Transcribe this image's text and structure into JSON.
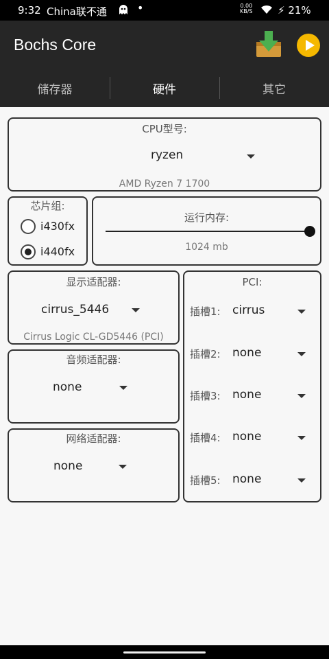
{
  "status": {
    "time": "9:32",
    "carrier": "China联不通",
    "ghost_icon": "ghost-icon",
    "dot": "•",
    "net_value": "0.00",
    "net_unit": "KB/S",
    "battery": "21%"
  },
  "appbar": {
    "title": "Bochs Core",
    "download_icon": "download-box-icon",
    "play_icon": "play-icon"
  },
  "tabs": [
    {
      "label": "储存器"
    },
    {
      "label": "硬件"
    },
    {
      "label": "其它"
    }
  ],
  "cpu": {
    "label": "CPU型号:",
    "value": "ryzen",
    "description": "AMD Ryzen 7 1700"
  },
  "chipset": {
    "label": "芯片组:",
    "options": [
      {
        "label": "i430fx",
        "checked": false
      },
      {
        "label": "i440fx",
        "checked": true
      }
    ]
  },
  "memory": {
    "label": "运行内存:",
    "value": "1024 mb",
    "level": 1.0
  },
  "display": {
    "label": "显示适配器:",
    "value": "cirrus_5446",
    "description": "Cirrus Logic CL-GD5446 (PCI)"
  },
  "audio": {
    "label": "音频适配器:",
    "value": "none"
  },
  "network": {
    "label": "网络适配器:",
    "value": "none"
  },
  "pci": {
    "label": "PCI:",
    "slots": [
      {
        "label": "插槽1:",
        "value": "cirrus"
      },
      {
        "label": "插槽2:",
        "value": "none"
      },
      {
        "label": "插槽3:",
        "value": "none"
      },
      {
        "label": "插槽4:",
        "value": "none"
      },
      {
        "label": "插槽5:",
        "value": "none"
      }
    ]
  },
  "colors": {
    "appbar": "#262626",
    "play_yellow": "#f5b800",
    "download_green": "#4caf50"
  }
}
